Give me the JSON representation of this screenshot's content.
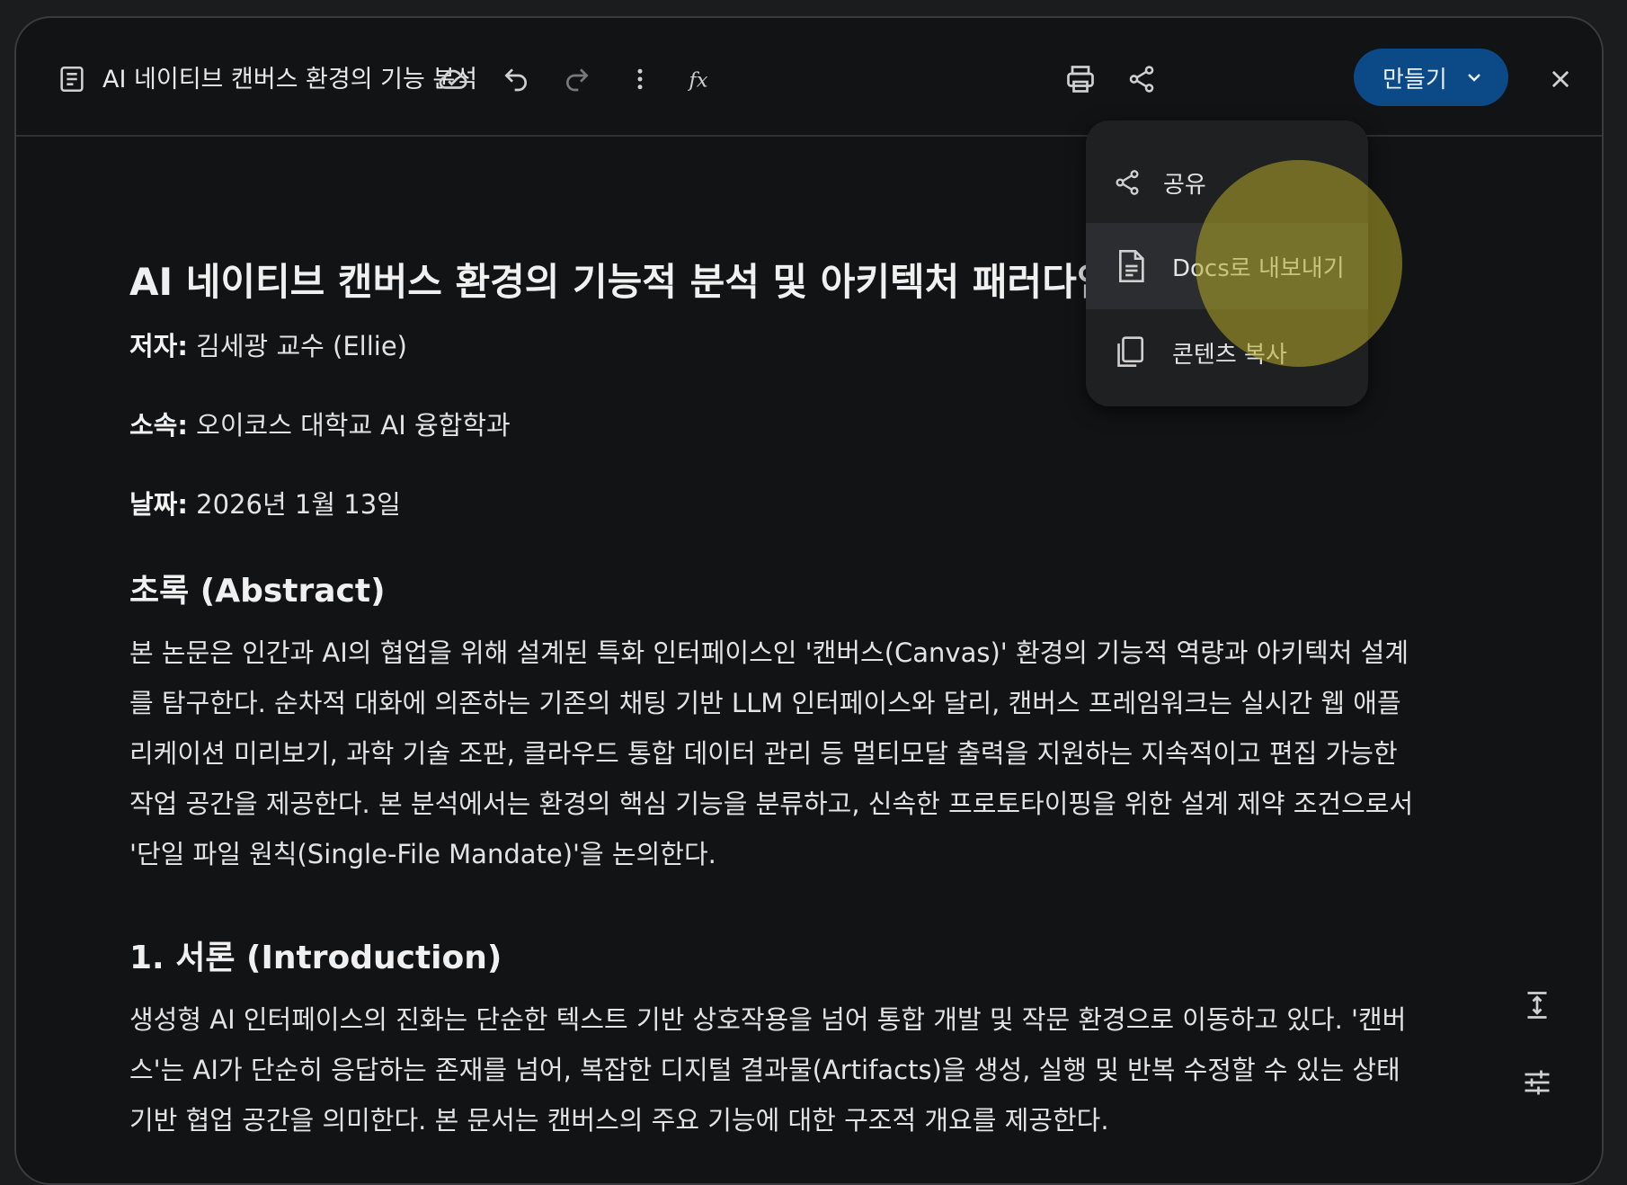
{
  "toolbar": {
    "doc_title": "AI 네이티브 캔버스 환경의 기능 분석",
    "icons": [
      "document-icon",
      "cloud-save-icon",
      "undo-icon",
      "redo-icon",
      "more-vert-icon",
      "function-fx-icon",
      "print-icon",
      "share-icon",
      "close-icon"
    ],
    "create_label": "만들기"
  },
  "menu": {
    "items": [
      {
        "label": "공유",
        "icon": "share-icon"
      },
      {
        "label": "Docs로 내보내기",
        "icon": "docs-icon"
      },
      {
        "label": "콘텐츠 복사",
        "icon": "copy-icon"
      }
    ]
  },
  "doc": {
    "title": "AI 네이티브 캔버스 환경의 기능적 분석 및 아키텍처 패러다임",
    "author_label": "저자:",
    "author_value": " 김세광 교수 (Ellie)",
    "affiliation_label": "소속:",
    "affiliation_value": " 오이코스 대학교 AI 융합학과",
    "date_label": "날짜:",
    "date_value": " 2026년 1월 13일",
    "abstract_heading": "초록 (Abstract)",
    "abstract_lines": [
      "본 논문은 인간과 AI의 협업을 위해 설계된 특화 인터페이스인 '캔버스(Canvas)' 환경의 기능적 역량과 아키텍처 설계",
      "를 탐구한다. 순차적 대화에 의존하는 기존의 채팅 기반 LLM 인터페이스와 달리, 캔버스 프레임워크는 실시간 웹 애플",
      "리케이션 미리보기, 과학 기술 조판, 클라우드 통합 데이터 관리 등 멀티모달 출력을 지원하는 지속적이고 편집 가능한",
      "작업 공간을 제공한다. 본 분석에서는 환경의 핵심 기능을 분류하고, 신속한 프로토타이핑을 위한 설계 제약 조건으로서",
      "'단일 파일 원칙(Single-File Mandate)'을 논의한다."
    ],
    "intro_heading": "1. 서론 (Introduction)",
    "intro_lines": [
      "생성형 AI 인터페이스의 진화는 단순한 텍스트 기반 상호작용을 넘어 통합 개발 및 작문 환경으로 이동하고 있다. '캔버",
      "스'는 AI가 단순히 응답하는 존재를 넘어, 복잡한 디지털 결과물(Artifacts)을 생성, 실행 및 반복 수정할 수 있는 상태",
      "기반 협업 공간을 의미한다. 본 문서는 캔버스의 주요 기능에 대한 구조적 개요를 제공한다."
    ]
  },
  "side_tools": [
    "expand-height-icon",
    "tune-icon"
  ],
  "colors": {
    "background": "#121314",
    "accent": "#0b4a86",
    "spellcheck": "#d93025"
  }
}
